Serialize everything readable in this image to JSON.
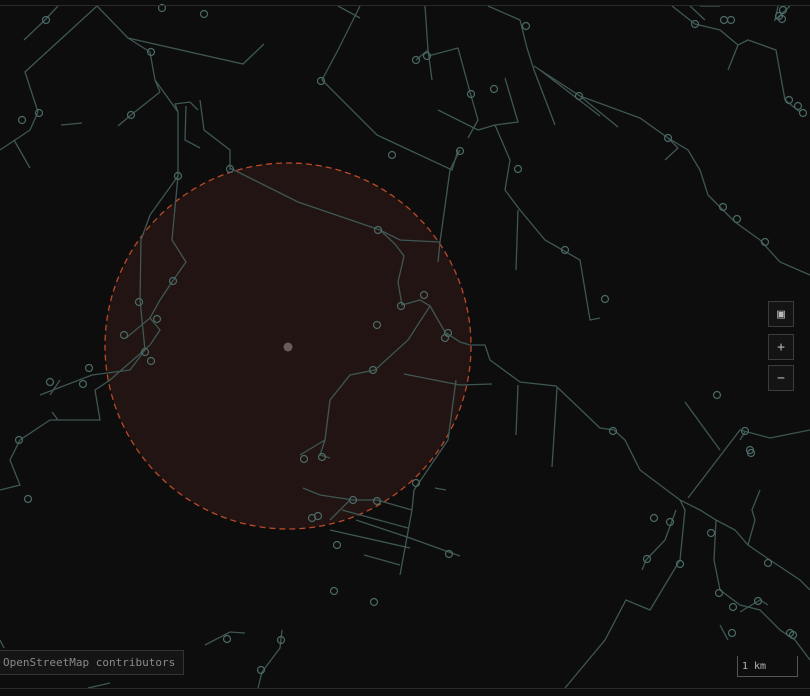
{
  "map": {
    "controls": {
      "layers_icon": "▣",
      "zoom_in": "+",
      "zoom_out": "−"
    },
    "attribution": "OpenStreetMap contributors",
    "scale_label": "1 km",
    "colors": {
      "background": "#0d0d0d",
      "road": "#3f5a57",
      "node": "#4a6a66",
      "radius_stroke": "#c0502c",
      "radius_fill": "#2a1613",
      "center_marker": "#6b5b58"
    }
  }
}
